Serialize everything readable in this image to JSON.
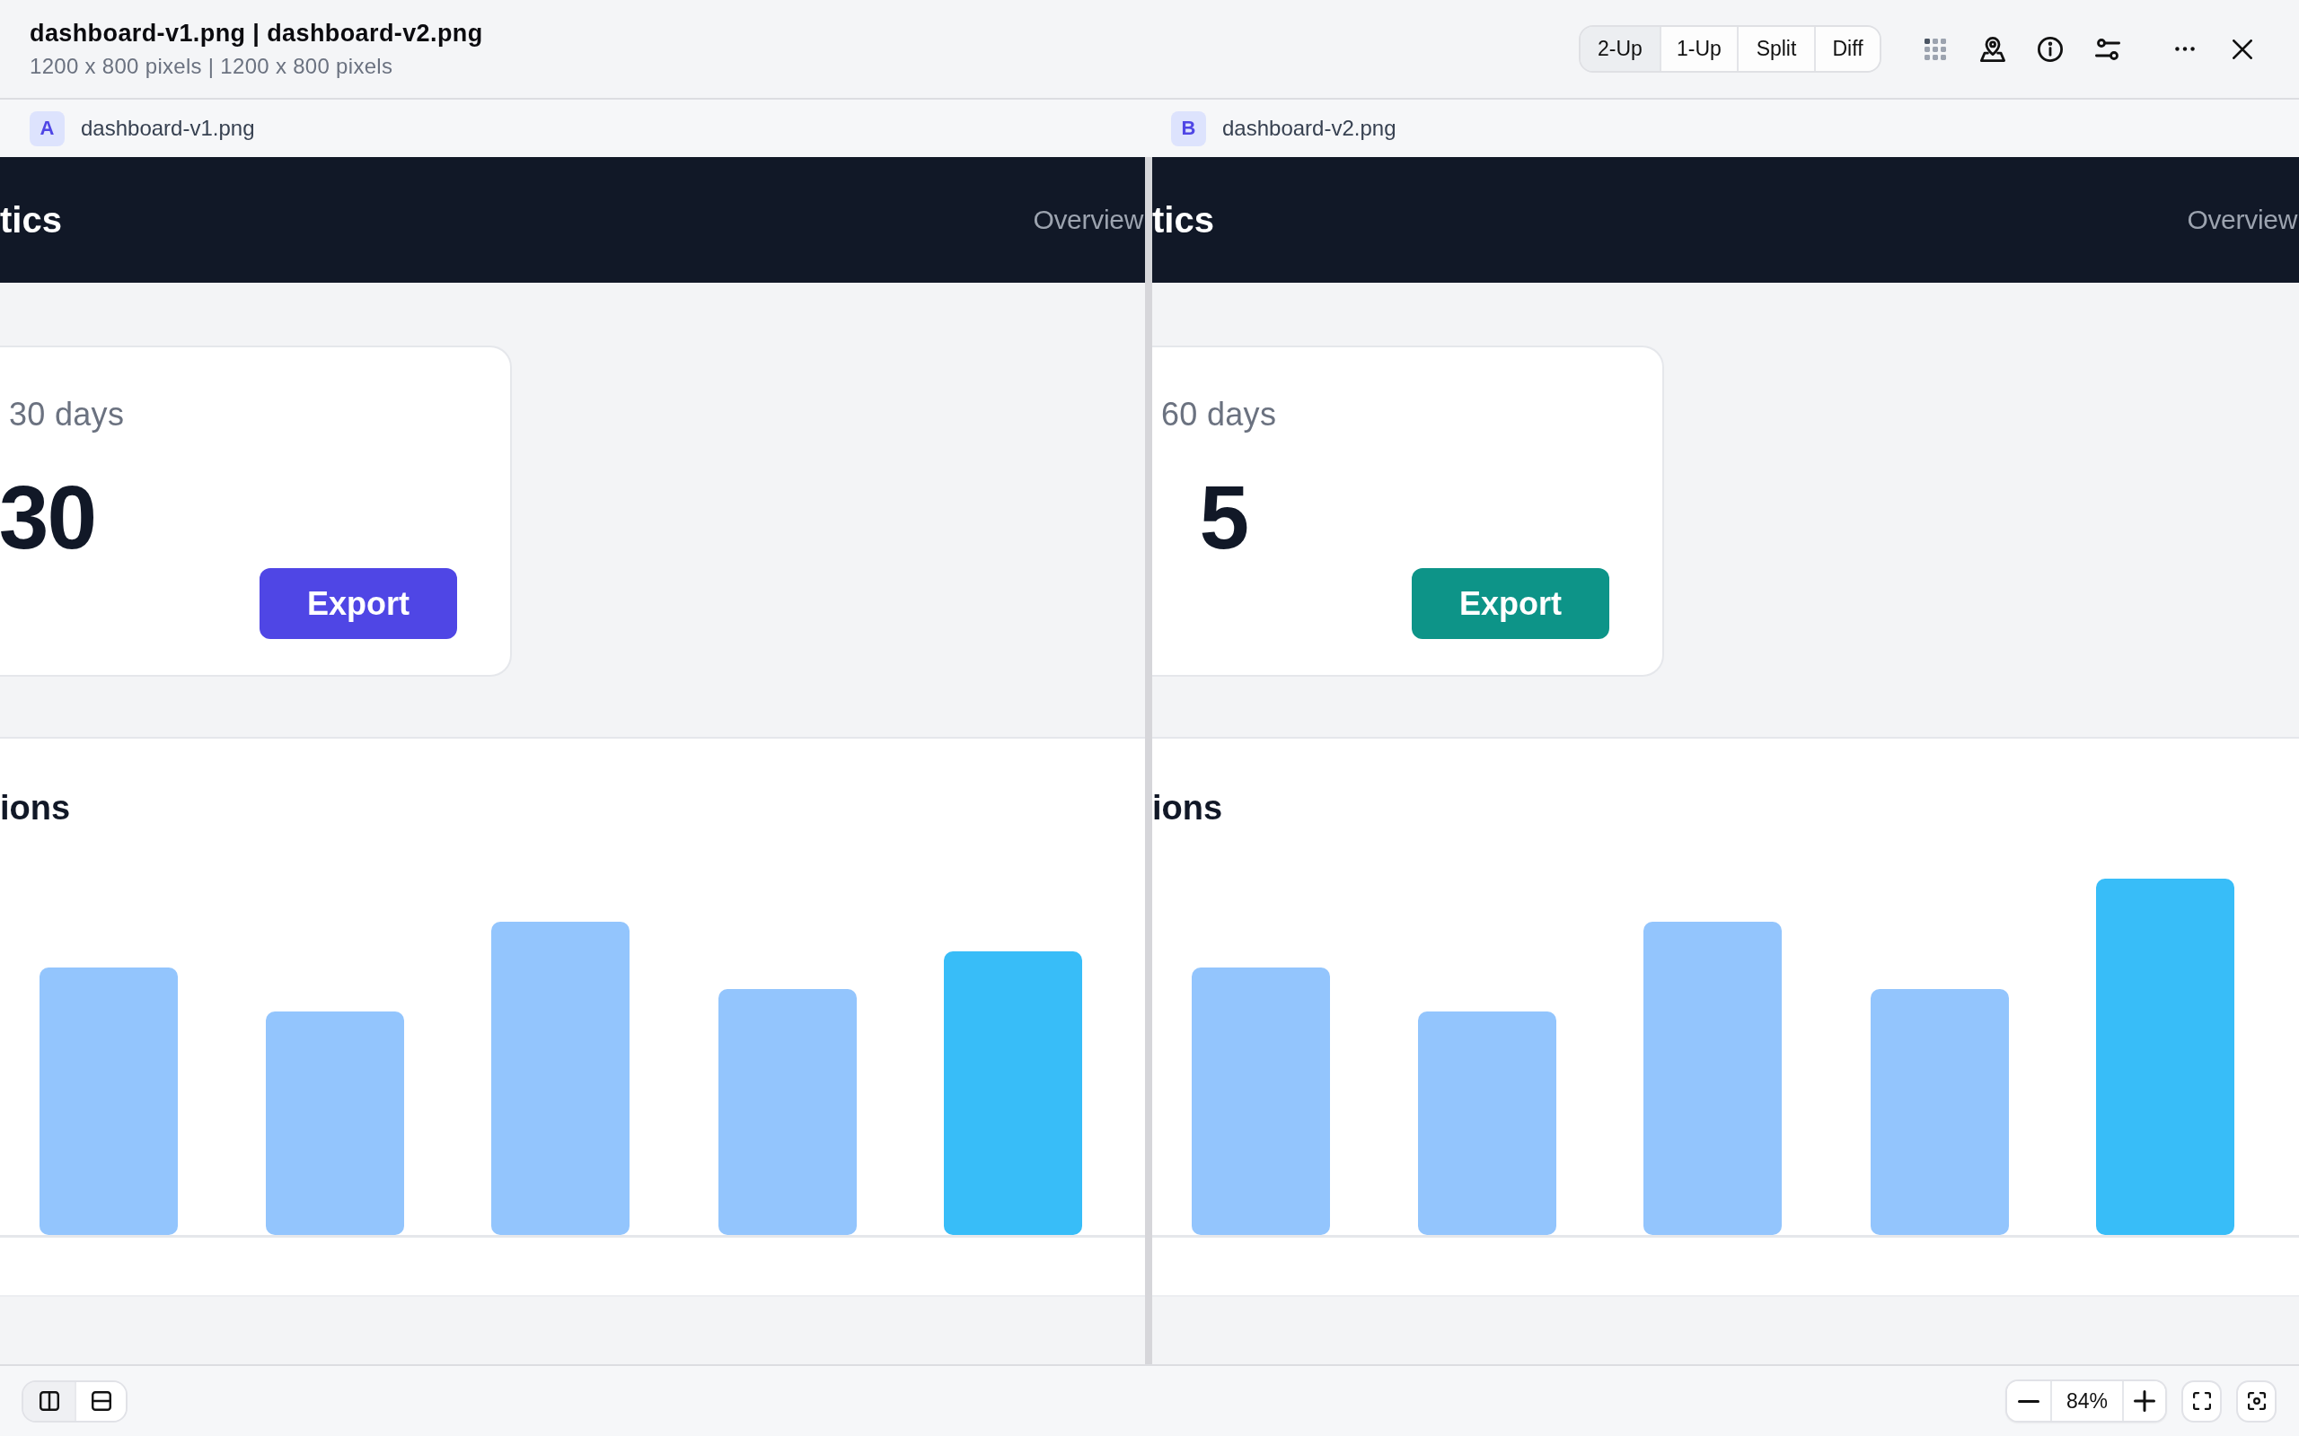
{
  "window": {
    "title": "dashboard-v1.png | dashboard-v2.png",
    "subtitle": "1200 x 800 pixels | 1200 x 800 pixels"
  },
  "view_modes": [
    {
      "label": "2-Up",
      "selected": true
    },
    {
      "label": "1-Up",
      "selected": false
    },
    {
      "label": "Split",
      "selected": false
    },
    {
      "label": "Diff",
      "selected": false
    }
  ],
  "panes": [
    {
      "badge": "A",
      "file_name": "dashboard-v1.png",
      "header_title": "tics",
      "nav_item": "Overview",
      "stat_label": "30 days",
      "stat_value": "30",
      "export_button": {
        "label": "Export",
        "color": "#4f46e5"
      },
      "chart_title": "ions"
    },
    {
      "badge": "B",
      "file_name": "dashboard-v2.png",
      "header_title": "tics",
      "nav_item": "Overview",
      "stat_label": "60 days",
      "stat_value": "5",
      "export_button": {
        "label": "Export",
        "color": "#0d9488"
      },
      "chart_title": "ions"
    }
  ],
  "layout_buttons": [
    {
      "kind": "columns",
      "selected": true
    },
    {
      "kind": "rows",
      "selected": false
    }
  ],
  "zoom": {
    "value": "84%"
  }
}
